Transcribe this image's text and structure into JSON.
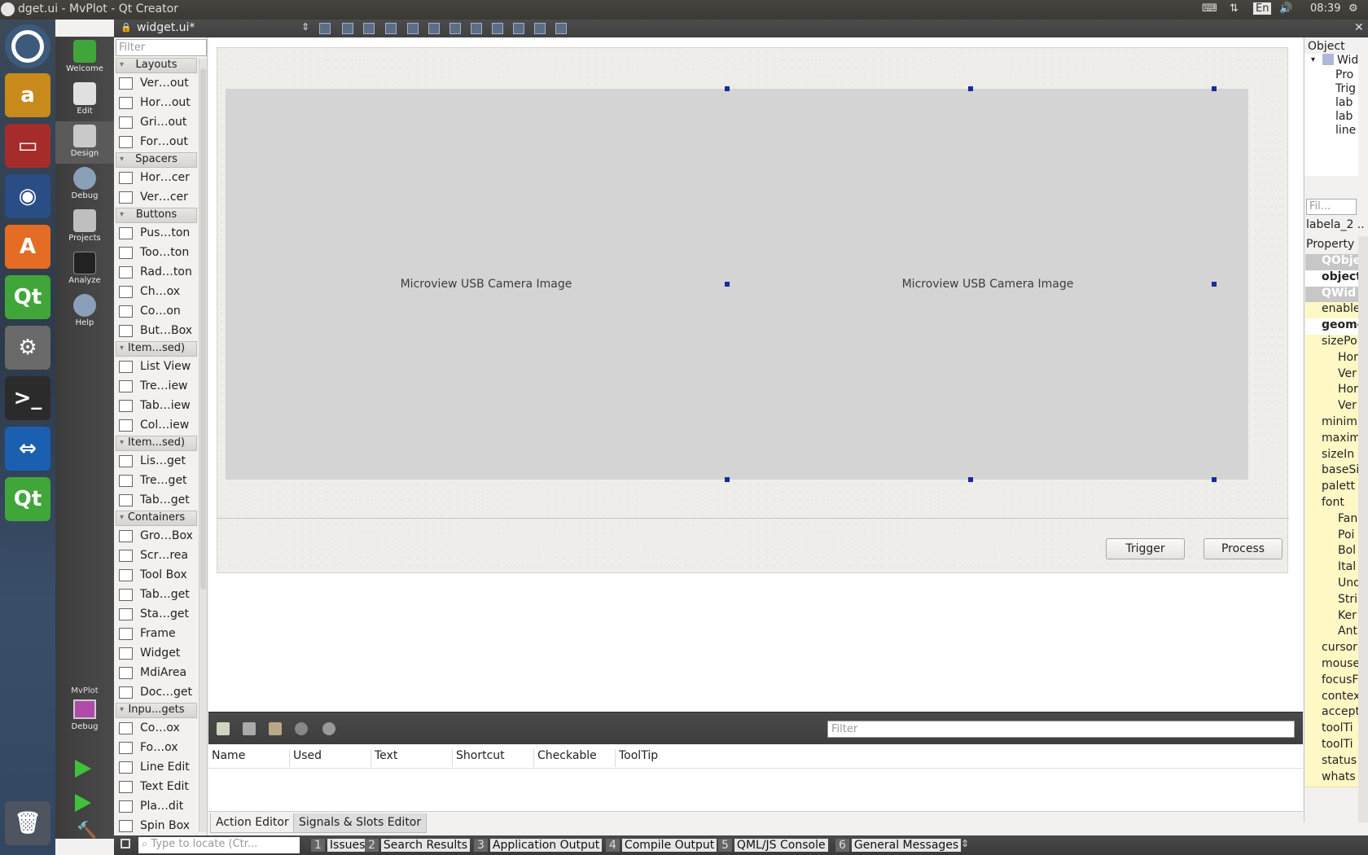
{
  "window": {
    "title": "dget.ui - MvPlot - Qt Creator"
  },
  "tray": {
    "lang": "En",
    "time": "08:39"
  },
  "modes": [
    {
      "label": "Welcome"
    },
    {
      "label": "Edit"
    },
    {
      "label": "Design"
    },
    {
      "label": "Debug"
    },
    {
      "label": "Projects"
    },
    {
      "label": "Analyze"
    },
    {
      "label": "Help"
    }
  ],
  "kit": {
    "project": "MvPlot",
    "config": "Debug"
  },
  "editor": {
    "file": "widget.ui*"
  },
  "widgetbox": {
    "filter_placeholder": "Filter",
    "categories": [
      "Layouts",
      "Spacers",
      "Buttons",
      "Item...sed)",
      "Item...sed)",
      "Containers",
      "Inpu...gets"
    ],
    "items": [
      "Ver…out",
      "Hor…out",
      "Gri…out",
      "For…out",
      "Hor…cer",
      "Ver…cer",
      "Pus…ton",
      "Too…ton",
      "Rad…ton",
      "Ch…ox",
      "Co…on",
      "But…Box",
      "List View",
      "Tre…iew",
      "Tab…iew",
      "Col…iew",
      "Lis…get",
      "Tre…get",
      "Tab…get",
      "Gro…Box",
      "Scr…rea",
      "Tool Box",
      "Tab…get",
      "Sta…get",
      "Frame",
      "Widget",
      "MdiArea",
      "Doc…get",
      "Co…ox",
      "Fo…ox",
      "Line Edit",
      "Text Edit",
      "Pla…dit",
      "Spin Box"
    ]
  },
  "form": {
    "label1": "Microview USB Camera Image",
    "label2": "Microview USB Camera Image",
    "trigger": "Trigger",
    "process": "Process"
  },
  "actions": {
    "filter_placeholder": "Filter",
    "columns": [
      "Name",
      "Used",
      "Text",
      "Shortcut",
      "Checkable",
      "ToolTip"
    ],
    "tabs": [
      "Action Editor",
      "Signals & Slots Editor"
    ]
  },
  "inspector": {
    "header": "Object",
    "objects": [
      "Wid",
      "Pro",
      "Trig",
      "lab",
      "lab",
      "line"
    ],
    "filter_placeholder": "Fil...",
    "selected": "labela_2 ..",
    "prop_header": "Property",
    "props": [
      "QObje",
      "object",
      "QWid",
      "enable",
      "geome",
      "sizePo",
      "Hor",
      "Ver",
      "Hor",
      "Ver",
      "minim",
      "maxim",
      "sizeIn",
      "baseSi",
      "palett",
      "font",
      "Fan",
      "Poi",
      "Bol",
      "Ital",
      "Und",
      "Stri",
      "Ker",
      "Ant",
      "cursor",
      "mouse",
      "focusF",
      "contex",
      "accept",
      "toolTi",
      "toolTi",
      "status",
      "whats"
    ]
  },
  "statusbar": {
    "locate_placeholder": "Type to locate (Ctr...",
    "panes": [
      {
        "n": "1",
        "label": "Issues"
      },
      {
        "n": "2",
        "label": "Search Results"
      },
      {
        "n": "3",
        "label": "Application Output"
      },
      {
        "n": "4",
        "label": "Compile Output"
      },
      {
        "n": "5",
        "label": "QML/JS Console"
      },
      {
        "n": "6",
        "label": "General Messages"
      }
    ]
  }
}
